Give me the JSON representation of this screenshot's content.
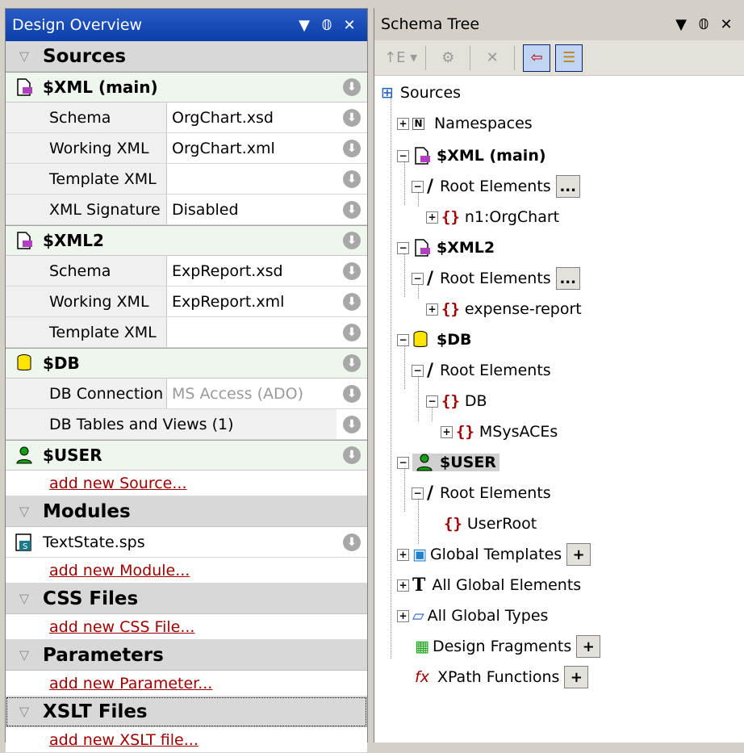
{
  "left_panel": {
    "title": "Design Overview",
    "sources_header": "Sources",
    "xml_main": {
      "name": "$XML (main)",
      "rows": [
        {
          "key": "Schema",
          "value": "OrgChart.xsd"
        },
        {
          "key": "Working XML",
          "value": "OrgChart.xml"
        },
        {
          "key": "Template XML",
          "value": ""
        },
        {
          "key": "XML Signature",
          "value": "Disabled"
        }
      ]
    },
    "xml2": {
      "name": "$XML2",
      "rows": [
        {
          "key": "Schema",
          "value": "ExpReport.xsd"
        },
        {
          "key": "Working XML",
          "value": "ExpReport.xml"
        },
        {
          "key": "Template XML",
          "value": ""
        }
      ]
    },
    "db": {
      "name": "$DB",
      "connection_label": "DB Connection",
      "connection_value": "MS Access (ADO)",
      "tables_label": "DB Tables and Views (1)"
    },
    "user": {
      "name": "$USER"
    },
    "add_source": "add new Source...",
    "modules_header": "Modules",
    "module_file": "TextState.sps",
    "add_module": "add new Module...",
    "css_header": "CSS Files",
    "add_css": "add new CSS File...",
    "params_header": "Parameters",
    "add_param": "add new Parameter...",
    "xslt_header": "XSLT Files",
    "add_xslt": "add new XSLT file..."
  },
  "right_panel": {
    "title": "Schema Tree",
    "tree": {
      "root": "Sources",
      "namespaces": "Namespaces",
      "xml_main": "$XML (main)",
      "root_elements": "Root Elements",
      "orgchart": "n1:OrgChart",
      "xml2": "$XML2",
      "expense": "expense-report",
      "db": "$DB",
      "db_el": "DB",
      "msys": "MSysACEs",
      "user": "$USER",
      "userroot": "UserRoot",
      "global_templates": "Global Templates",
      "all_elements": "All Global Elements",
      "all_types": "All Global Types",
      "design_fragments": "Design Fragments",
      "xpath_functions": "XPath Functions"
    }
  },
  "icons": {
    "dropdown": "▼",
    "pin": "ᵽ",
    "close": "✕",
    "more": "...",
    "plus": "+"
  }
}
